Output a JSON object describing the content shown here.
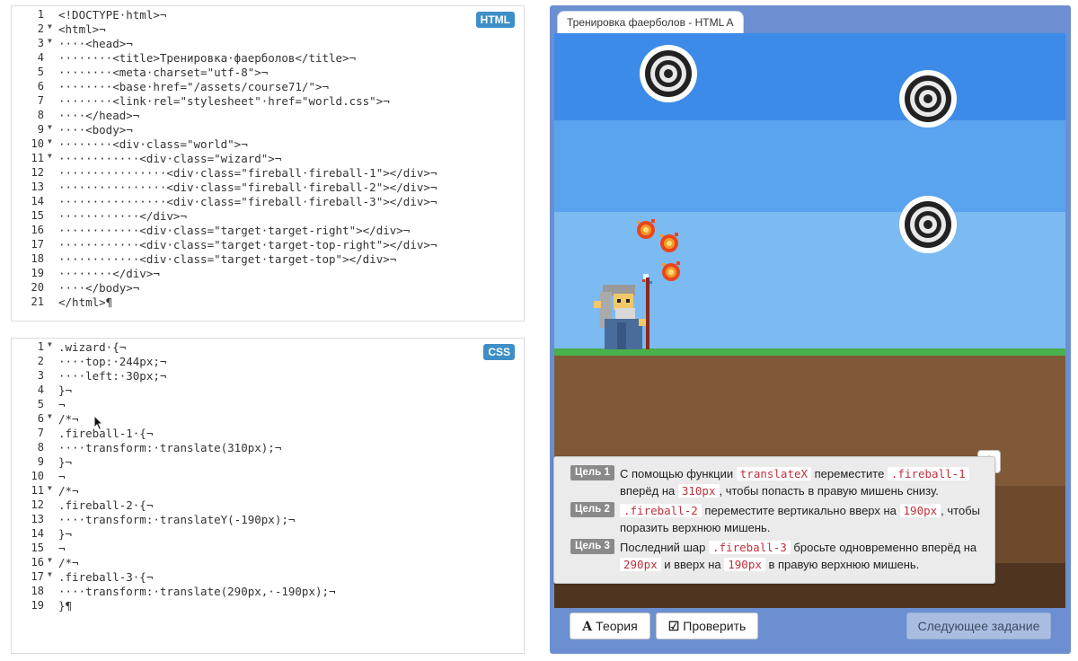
{
  "html_editor": {
    "badge": "HTML",
    "lines": [
      {
        "n": "1",
        "fold": false,
        "text": "<!DOCTYPE·html>¬"
      },
      {
        "n": "2",
        "fold": true,
        "text": "<html>¬"
      },
      {
        "n": "3",
        "fold": true,
        "text": "····<head>¬"
      },
      {
        "n": "4",
        "fold": false,
        "text": "········<title>Тренировка·фаерболов</title>¬"
      },
      {
        "n": "5",
        "fold": false,
        "text": "········<meta·charset=\"utf-8\">¬"
      },
      {
        "n": "6",
        "fold": false,
        "text": "········<base·href=\"/assets/course71/\">¬"
      },
      {
        "n": "7",
        "fold": false,
        "text": "········<link·rel=\"stylesheet\"·href=\"world.css\">¬"
      },
      {
        "n": "8",
        "fold": false,
        "text": "····</head>¬"
      },
      {
        "n": "9",
        "fold": true,
        "text": "····<body>¬"
      },
      {
        "n": "10",
        "fold": true,
        "text": "········<div·class=\"world\">¬"
      },
      {
        "n": "11",
        "fold": true,
        "text": "············<div·class=\"wizard\">¬"
      },
      {
        "n": "12",
        "fold": false,
        "text": "················<div·class=\"fireball·fireball-1\"></div>¬"
      },
      {
        "n": "13",
        "fold": false,
        "text": "················<div·class=\"fireball·fireball-2\"></div>¬"
      },
      {
        "n": "14",
        "fold": false,
        "text": "················<div·class=\"fireball·fireball-3\"></div>¬"
      },
      {
        "n": "15",
        "fold": false,
        "text": "············</div>¬"
      },
      {
        "n": "16",
        "fold": false,
        "text": "············<div·class=\"target·target-right\"></div>¬"
      },
      {
        "n": "17",
        "fold": false,
        "text": "············<div·class=\"target·target-top-right\"></div>¬"
      },
      {
        "n": "18",
        "fold": false,
        "text": "············<div·class=\"target·target-top\"></div>¬"
      },
      {
        "n": "19",
        "fold": false,
        "text": "········</div>¬"
      },
      {
        "n": "20",
        "fold": false,
        "text": "····</body>¬"
      },
      {
        "n": "21",
        "fold": false,
        "text": "</html>¶"
      }
    ]
  },
  "css_editor": {
    "badge": "CSS",
    "lines": [
      {
        "n": "1",
        "fold": true,
        "text": ".wizard·{¬"
      },
      {
        "n": "2",
        "fold": false,
        "text": "····top:·244px;¬"
      },
      {
        "n": "3",
        "fold": false,
        "text": "····left:·30px;¬"
      },
      {
        "n": "4",
        "fold": false,
        "text": "}¬"
      },
      {
        "n": "5",
        "fold": false,
        "text": "¬"
      },
      {
        "n": "6",
        "fold": true,
        "text": "/*¬"
      },
      {
        "n": "7",
        "fold": false,
        "text": ".fireball-1·{¬"
      },
      {
        "n": "8",
        "fold": false,
        "text": "····transform:·translate(310px);¬"
      },
      {
        "n": "9",
        "fold": false,
        "text": "}¬"
      },
      {
        "n": "10",
        "fold": false,
        "text": "¬"
      },
      {
        "n": "11",
        "fold": true,
        "text": "/*¬"
      },
      {
        "n": "12",
        "fold": false,
        "text": ".fireball-2·{¬"
      },
      {
        "n": "13",
        "fold": false,
        "text": "····transform:·translateY(-190px);¬"
      },
      {
        "n": "14",
        "fold": false,
        "text": "}¬"
      },
      {
        "n": "15",
        "fold": false,
        "text": "¬"
      },
      {
        "n": "16",
        "fold": true,
        "text": "/*¬"
      },
      {
        "n": "17",
        "fold": true,
        "text": ".fireball-3·{¬"
      },
      {
        "n": "18",
        "fold": false,
        "text": "····transform:·translate(290px,·-190px);¬"
      },
      {
        "n": "19",
        "fold": false,
        "text": "}¶"
      }
    ]
  },
  "game": {
    "tab_title": "Тренировка фаерболов - HTML A",
    "colors": {
      "sky_top": "#3d8be8",
      "grass": "#49b04a",
      "dirt": "#805a36"
    }
  },
  "tasks": [
    {
      "label": "Цель 1",
      "parts": [
        "С помощью функции ",
        "translateX",
        " переместите ",
        ".fireball-1",
        " вперёд на ",
        "310px",
        ", чтобы попасть в правую мишень снизу."
      ]
    },
    {
      "label": "Цель 2",
      "parts": [
        "",
        ".fireball-2",
        " переместите вертикально вверх на ",
        "190px",
        ", чтобы поразить верхнюю мишень."
      ]
    },
    {
      "label": "Цель 3",
      "parts": [
        "Последний шар ",
        ".fireball-3",
        " бросьте одновременно вперёд на ",
        "290px",
        " и вверх на ",
        "190px",
        " в правую верхнюю мишень."
      ]
    }
  ],
  "buttons": {
    "up": "↑",
    "theory_icon": "A",
    "theory": "Теория",
    "check_icon": "☑",
    "check": "Проверить",
    "next": "Следующее задание"
  }
}
